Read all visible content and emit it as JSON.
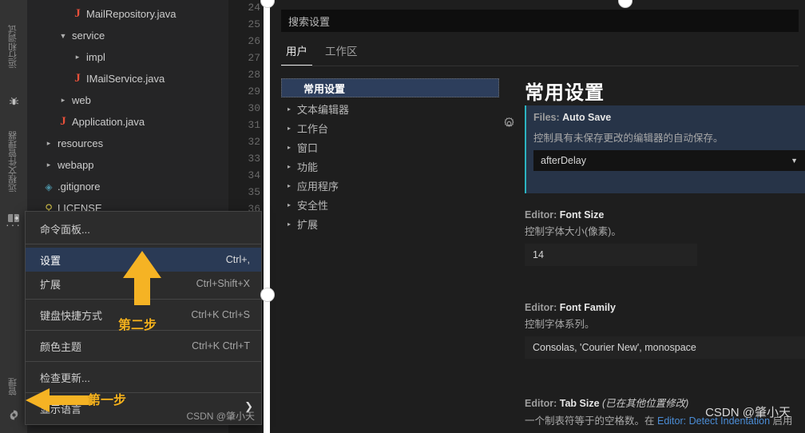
{
  "activitybar": {
    "items": [
      {
        "label": "运行和调试",
        "icon": "bug-icon"
      },
      {
        "label": "远程文件管理器",
        "icon": "remote-explorer-icon"
      }
    ],
    "more_label": "···",
    "manage": {
      "label": "管理",
      "icon": "gear-icon"
    }
  },
  "explorer": {
    "items": [
      {
        "label": "MailRepository.java",
        "icon": "java-file-icon",
        "indent": 3,
        "twisty": "",
        "kind": "java"
      },
      {
        "label": "service",
        "icon": "folder-icon",
        "indent": 2,
        "twisty": "▼",
        "kind": "folder"
      },
      {
        "label": "impl",
        "icon": "folder-icon",
        "indent": 3,
        "twisty": "▸",
        "kind": "folder"
      },
      {
        "label": "IMailService.java",
        "icon": "java-file-icon",
        "indent": 3,
        "twisty": "",
        "kind": "java"
      },
      {
        "label": "web",
        "icon": "folder-icon",
        "indent": 2,
        "twisty": "▸",
        "kind": "folder"
      },
      {
        "label": "Application.java",
        "icon": "java-file-icon",
        "indent": 2,
        "twisty": "",
        "kind": "java"
      },
      {
        "label": "resources",
        "icon": "folder-icon",
        "indent": 1,
        "twisty": "▸",
        "kind": "folder"
      },
      {
        "label": "webapp",
        "icon": "folder-icon",
        "indent": 1,
        "twisty": "▸",
        "kind": "folder"
      },
      {
        "label": ".gitignore",
        "icon": "git-file-icon",
        "indent": 1,
        "twisty": "",
        "kind": "git"
      },
      {
        "label": "LICENSE",
        "icon": "license-file-icon",
        "indent": 1,
        "twisty": "",
        "kind": "license"
      }
    ]
  },
  "editor": {
    "line_numbers": [
      "24",
      "25",
      "26",
      "27",
      "28",
      "29",
      "30",
      "31",
      "32",
      "33",
      "34",
      "35",
      "36"
    ]
  },
  "context_menu": {
    "items": [
      {
        "label": "命令面板...",
        "shortcut": "",
        "selected": false,
        "sep_after": true
      },
      {
        "label": "设置",
        "shortcut": "Ctrl+,",
        "selected": true,
        "sep_after": false
      },
      {
        "label": "扩展",
        "shortcut": "Ctrl+Shift+X",
        "selected": false,
        "sep_after": true
      },
      {
        "label": "键盘快捷方式",
        "shortcut": "Ctrl+K Ctrl+S",
        "selected": false,
        "sep_after": true
      },
      {
        "label": "颜色主题",
        "shortcut": "Ctrl+K Ctrl+T",
        "selected": false,
        "sep_after": true
      },
      {
        "label": "检查更新...",
        "shortcut": "",
        "selected": false,
        "sep_after": false
      },
      {
        "label": "显示语言",
        "shortcut": "",
        "selected": false,
        "sep_after": false
      }
    ],
    "submenu_chevron": "❯",
    "watermark": "CSDN @肇小天"
  },
  "settings": {
    "search_placeholder": "搜索设置",
    "search_value": "",
    "tabs": [
      {
        "label": "用户",
        "active": true
      },
      {
        "label": "工作区",
        "active": false
      }
    ],
    "tree": [
      {
        "label": "常用设置",
        "twisty": "",
        "selected": true
      },
      {
        "label": "文本编辑器",
        "twisty": "▸",
        "selected": false
      },
      {
        "label": "工作台",
        "twisty": "▸",
        "selected": false
      },
      {
        "label": "窗口",
        "twisty": "▸",
        "selected": false
      },
      {
        "label": "功能",
        "twisty": "▸",
        "selected": false
      },
      {
        "label": "应用程序",
        "twisty": "▸",
        "selected": false
      },
      {
        "label": "安全性",
        "twisty": "▸",
        "selected": false
      },
      {
        "label": "扩展",
        "twisty": "▸",
        "selected": false
      }
    ],
    "detail_title": "常用设置",
    "entries": {
      "auto_save": {
        "key_prefix": "Files: ",
        "key_name": "Auto Save",
        "description": "控制具有未保存更改的编辑器的自动保存。",
        "value": "afterDelay",
        "caret": "▼"
      },
      "font_size": {
        "key_prefix": "Editor: ",
        "key_name": "Font Size",
        "description": "控制字体大小(像素)。",
        "value": "14"
      },
      "font_family": {
        "key_prefix": "Editor: ",
        "key_name": "Font Family",
        "description": "控制字体系列。",
        "value": "Consolas, 'Courier New', monospace"
      },
      "tab_size": {
        "key_prefix": "Editor: ",
        "key_name": "Tab Size",
        "modified_note": "(已在其他位置修改)",
        "description_part1": "一个制表符等于的空格数。在 ",
        "description_link": "Editor: Detect Indentation",
        "description_part2": " 启用"
      }
    }
  },
  "annotations": {
    "step_one": "第一步",
    "step_two": "第二步",
    "colors": {
      "arrow": "#f5b324",
      "text": "#f2b01e",
      "handle": "#ffffff"
    }
  },
  "watermarks": {
    "main": "CSDN @肇小天",
    "menu": "CSDN @肇小天"
  }
}
